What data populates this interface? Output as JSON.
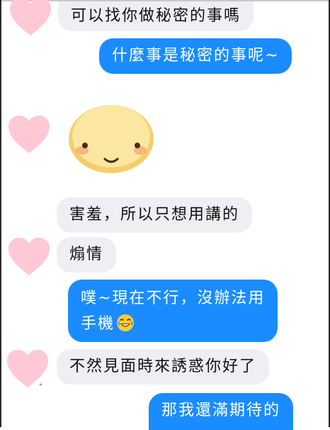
{
  "messages": [
    {
      "from": "other",
      "text": "可以找你做秘密的事嗎"
    },
    {
      "from": "me",
      "text": "什麼事是秘密的事呢~"
    },
    {
      "from": "other",
      "sticker": "blushing-face-sticker"
    },
    {
      "from": "other",
      "text": "害羞，所以只想用講的"
    },
    {
      "from": "other",
      "text": "煽情"
    },
    {
      "from": "me",
      "text": "噗~現在不行，沒辦法用"
    },
    {
      "from": "me",
      "text": "手機",
      "emoji": "laughing-tears-emoji"
    },
    {
      "from": "other",
      "text": "不然見面時來誘惑你好了"
    },
    {
      "from": "me",
      "text": "那我還滿期待的"
    }
  ],
  "theme": {
    "incoming_bubble": "#eeeff2",
    "outgoing_bubble": "#1a8cff",
    "avatar_heart": "#ffc8d6",
    "avatar_icon": "pink-heart-icon"
  }
}
